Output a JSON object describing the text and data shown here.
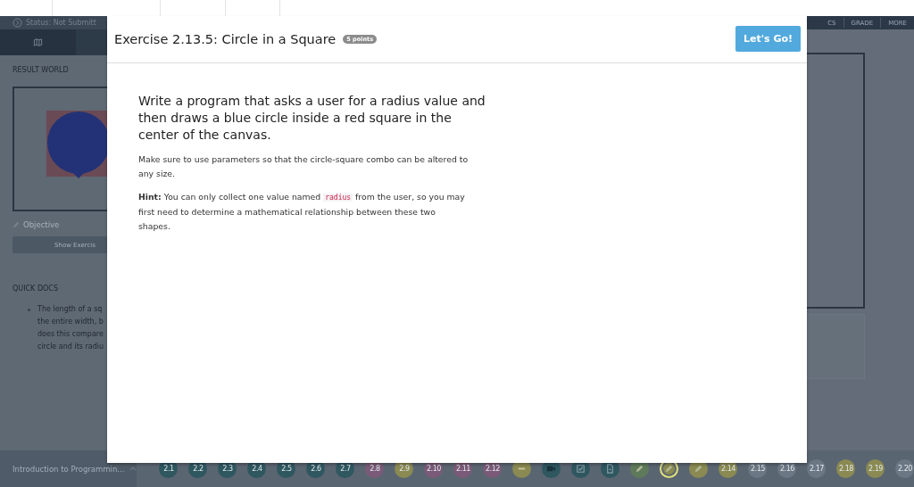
{
  "header": {
    "status": "Status: Not Submitt",
    "nav": [
      "CS",
      "GRADE",
      "MORE"
    ]
  },
  "sidebar": {
    "section_title": "RESULT WORLD",
    "objective": "Objective",
    "show_button": "Show Exercis",
    "docs_title": "QUICK DOCS",
    "docs_lines": [
      "The length of a sq",
      "the entire width, b",
      "does this compare",
      "circle and its radiu"
    ]
  },
  "modal": {
    "title": "Exercise 2.13.5: Circle in a Square",
    "badge": "5 points",
    "button": "Let's Go!",
    "heading": "Write a program that asks a user for a radius value and then draws a blue circle inside a red square in the center of the canvas.",
    "paragraph": "Make sure to use parameters so that the circle-square combo can be altered to any size.",
    "hint_label": "Hint:",
    "hint_before": "You can only collect one value named",
    "hint_code": "radius",
    "hint_after": "from the user, so you may first need to determine a mathematical relationship between these two shapes."
  },
  "footer": {
    "course": "Introduction to Programmin...",
    "steps": [
      {
        "kind": "step",
        "label": "2.1",
        "color": "#2f5760",
        "selected": false
      },
      {
        "kind": "step",
        "label": "2.2",
        "color": "#2f5760",
        "selected": false
      },
      {
        "kind": "step",
        "label": "2.3",
        "color": "#2f5760",
        "selected": false
      },
      {
        "kind": "step",
        "label": "2.4",
        "color": "#2f5760",
        "selected": false
      },
      {
        "kind": "step",
        "label": "2.5",
        "color": "#2f5760",
        "selected": false
      },
      {
        "kind": "step",
        "label": "2.6",
        "color": "#2f5760",
        "selected": false
      },
      {
        "kind": "step",
        "label": "2.7",
        "color": "#2f5760",
        "selected": false
      },
      {
        "kind": "step",
        "label": "2.8",
        "color": "#7a5a78",
        "selected": false
      },
      {
        "kind": "step",
        "label": "2.9",
        "color": "#8a8a52",
        "selected": false
      },
      {
        "kind": "step",
        "label": "2.10",
        "color": "#7a5a78",
        "selected": false
      },
      {
        "kind": "step",
        "label": "2.11",
        "color": "#7a5a78",
        "selected": false
      },
      {
        "kind": "step",
        "label": "2.12",
        "color": "#7a5a78",
        "selected": false
      },
      {
        "kind": "minus",
        "color": "#8a8a52",
        "selected": false
      },
      {
        "kind": "video",
        "color": "#2f5760",
        "selected": false
      },
      {
        "kind": "check",
        "color": "#2f5760",
        "selected": false
      },
      {
        "kind": "doc",
        "color": "#2f5760",
        "selected": false
      },
      {
        "kind": "pencil",
        "color": "#5e7a5a",
        "selected": false
      },
      {
        "kind": "pencil",
        "color": "#8a8a52",
        "selected": true
      },
      {
        "kind": "pencil",
        "color": "#8a8a52",
        "selected": false
      },
      {
        "kind": "step",
        "label": "2.14",
        "color": "#8a8a52",
        "selected": false
      },
      {
        "kind": "step",
        "label": "2.15",
        "color": "#6b7784",
        "selected": false
      },
      {
        "kind": "step",
        "label": "2.16",
        "color": "#6b7784",
        "selected": false
      },
      {
        "kind": "step",
        "label": "2.17",
        "color": "#6b7784",
        "selected": false
      },
      {
        "kind": "step",
        "label": "2.18",
        "color": "#8a8a52",
        "selected": false
      },
      {
        "kind": "step",
        "label": "2.19",
        "color": "#8a8a52",
        "selected": false
      },
      {
        "kind": "step",
        "label": "2.20",
        "color": "#6b7784",
        "selected": false
      }
    ]
  }
}
